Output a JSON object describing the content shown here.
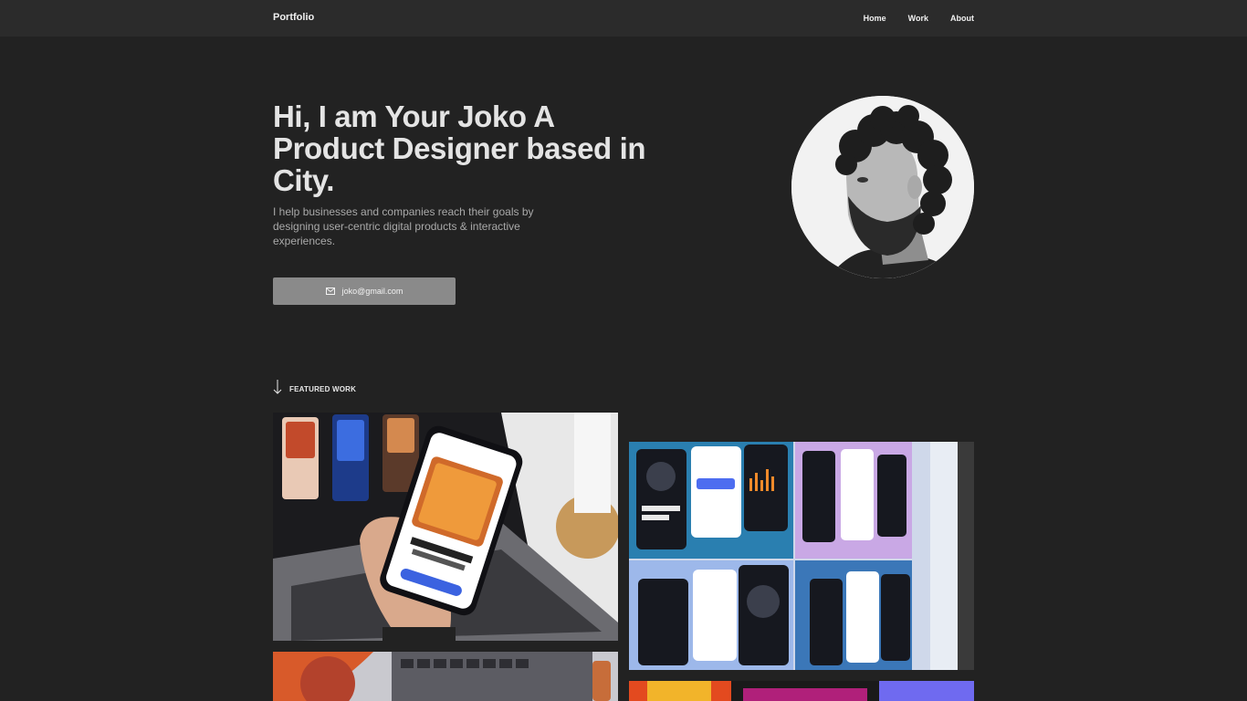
{
  "nav": {
    "brand": "Portfolio",
    "links": [
      "Home",
      "Work",
      "About"
    ]
  },
  "hero": {
    "title": "Hi, I am Your Joko A Product Designer based in City.",
    "subtitle": "I help businesses and companies reach their goals by designing user-centric digital products & interactive experiences.",
    "email": "joko@gmail.com"
  },
  "featured": {
    "label": "FEATURED WORK"
  },
  "colors": {
    "background": "#222222",
    "navbar": "#2b2b2b",
    "button": "#8a8a8a"
  },
  "icons": {
    "mail": "mail-icon",
    "arrow": "arrow-down-icon"
  }
}
